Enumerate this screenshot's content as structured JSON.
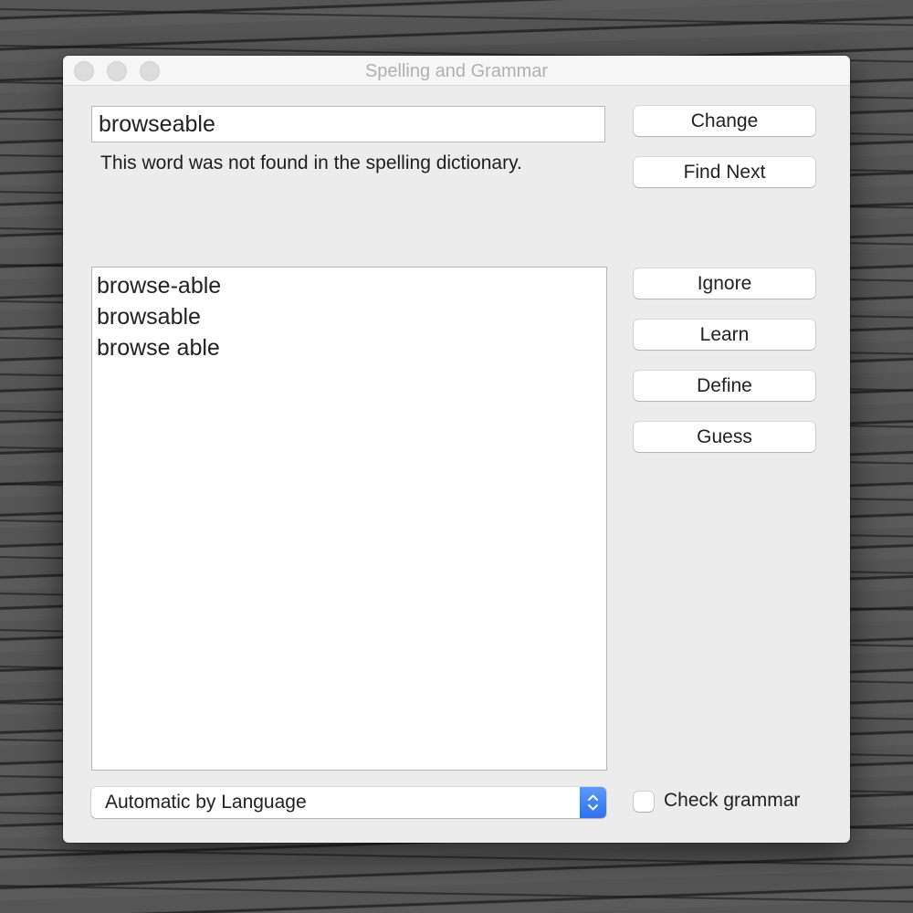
{
  "window": {
    "title": "Spelling and Grammar",
    "controls": [
      "close",
      "minimize",
      "maximize"
    ]
  },
  "misspelled_word": "browseable",
  "message": "This word was not found in the spelling dictionary.",
  "suggestions": [
    "browse-able",
    "browsable",
    "browse able"
  ],
  "buttons": {
    "change": "Change",
    "find_next": "Find Next",
    "ignore": "Ignore",
    "learn": "Learn",
    "define": "Define",
    "guess": "Guess"
  },
  "language_select": {
    "selected": "Automatic by Language",
    "icon": "up-down-chevron-icon",
    "accent_color": "#3478f6"
  },
  "check_grammar": {
    "label": "Check grammar",
    "checked": false
  }
}
